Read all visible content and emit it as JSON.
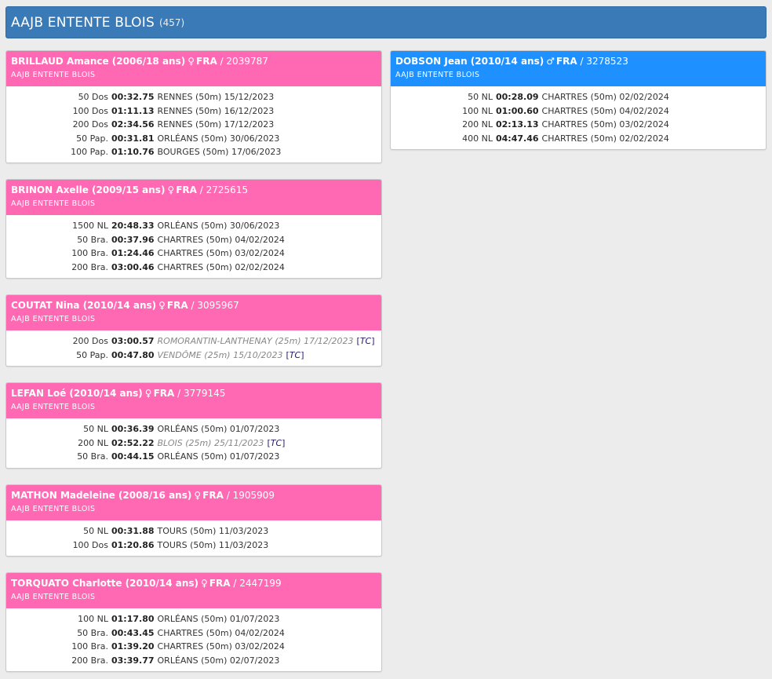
{
  "club": {
    "name": "AAJB ENTENTE BLOIS",
    "count": "(457)"
  },
  "swimmers": [
    {
      "id": "brillaud",
      "name": "BRILLAUD Amance (2006/18 ans)",
      "sex_symbol": "♀",
      "nation": "FRA",
      "license": "/ 2039787",
      "club": "AAJB ENTENTE BLOIS",
      "results": [
        {
          "event": "50 Dos",
          "time": "00:32.75",
          "place": "RENNES (50m) 15/12/2023"
        },
        {
          "event": "100 Dos",
          "time": "01:11.13",
          "place": "RENNES (50m) 16/12/2023"
        },
        {
          "event": "200 Dos",
          "time": "02:34.56",
          "place": "RENNES (50m) 17/12/2023"
        },
        {
          "event": "50 Pap.",
          "time": "00:31.81",
          "place": "ORLÉANS (50m) 30/06/2023"
        },
        {
          "event": "100 Pap.",
          "time": "01:10.76",
          "place": "BOURGES (50m) 17/06/2023"
        }
      ]
    },
    {
      "id": "brinon",
      "name": "BRINON Axelle (2009/15 ans)",
      "sex_symbol": "♀",
      "nation": "FRA",
      "license": "/ 2725615",
      "club": "AAJB ENTENTE BLOIS",
      "results": [
        {
          "event": "1500 NL",
          "time": "20:48.33",
          "place": "ORLÉANS (50m) 30/06/2023"
        },
        {
          "event": "50 Bra.",
          "time": "00:37.96",
          "place": "CHARTRES (50m) 04/02/2024"
        },
        {
          "event": "100 Bra.",
          "time": "01:24.46",
          "place": "CHARTRES (50m) 03/02/2024"
        },
        {
          "event": "200 Bra.",
          "time": "03:00.46",
          "place": "CHARTRES (50m) 02/02/2024"
        }
      ]
    },
    {
      "id": "coutat",
      "name": "COUTAT Nina (2010/14 ans)",
      "sex_symbol": "♀",
      "nation": "FRA",
      "license": "/ 3095967",
      "club": "AAJB ENTENTE BLOIS",
      "results": [
        {
          "event": "200 Dos",
          "time": "03:00.57",
          "place": "ROMORANTIN-LANTHENAY (25m) 17/12/2023",
          "tc": "TC"
        },
        {
          "event": "50 Pap.",
          "time": "00:47.80",
          "place": "VENDÔME (25m) 15/10/2023",
          "tc": "TC"
        }
      ]
    },
    {
      "id": "lefan",
      "name": "LEFAN Loé (2010/14 ans)",
      "sex_symbol": "♀",
      "nation": "FRA",
      "license": "/ 3779145",
      "club": "AAJB ENTENTE BLOIS",
      "results": [
        {
          "event": "50 NL",
          "time": "00:36.39",
          "place": "ORLÉANS (50m) 01/07/2023"
        },
        {
          "event": "200 NL",
          "time": "02:52.22",
          "place": "BLOIS (25m) 25/11/2023",
          "tc": "TC"
        },
        {
          "event": "50 Bra.",
          "time": "00:44.15",
          "place": "ORLÉANS (50m) 01/07/2023"
        }
      ]
    },
    {
      "id": "mathon",
      "name": "MATHON Madeleine (2008/16 ans)",
      "sex_symbol": "♀",
      "nation": "FRA",
      "license": "/ 1905909",
      "club": "AAJB ENTENTE BLOIS",
      "results": [
        {
          "event": "50 NL",
          "time": "00:31.88",
          "place": "TOURS (50m) 11/03/2023"
        },
        {
          "event": "100 Dos",
          "time": "01:20.86",
          "place": "TOURS (50m) 11/03/2023"
        }
      ]
    },
    {
      "id": "torquato",
      "name": "TORQUATO Charlotte (2010/14 ans)",
      "sex_symbol": "♀",
      "nation": "FRA",
      "license": "/ 2447199",
      "club": "AAJB ENTENTE BLOIS",
      "results": [
        {
          "event": "100 NL",
          "time": "01:17.80",
          "place": "ORLÉANS (50m) 01/07/2023"
        },
        {
          "event": "50 Bra.",
          "time": "00:43.45",
          "place": "CHARTRES (50m) 04/02/2024"
        },
        {
          "event": "100 Bra.",
          "time": "01:39.20",
          "place": "CHARTRES (50m) 03/02/2024"
        },
        {
          "event": "200 Bra.",
          "time": "03:39.77",
          "place": "ORLÉANS (50m) 02/07/2023"
        }
      ]
    },
    {
      "id": "dobson",
      "name": "DOBSON Jean (2010/14 ans)",
      "sex_symbol": "♂",
      "nation": "FRA",
      "license": "/ 3278523",
      "club": "AAJB ENTENTE BLOIS",
      "results": [
        {
          "event": "50 NL",
          "time": "00:28.09",
          "place": "CHARTRES (50m) 02/02/2024"
        },
        {
          "event": "100 NL",
          "time": "01:00.60",
          "place": "CHARTRES (50m) 04/02/2024"
        },
        {
          "event": "200 NL",
          "time": "02:13.13",
          "place": "CHARTRES (50m) 03/02/2024"
        },
        {
          "event": "400 NL",
          "time": "04:47.46",
          "place": "CHARTRES (50m) 02/02/2024"
        }
      ]
    }
  ],
  "colors": {
    "header": "#3a7ab7",
    "female": "#ff69b4",
    "male": "#1e90ff"
  }
}
